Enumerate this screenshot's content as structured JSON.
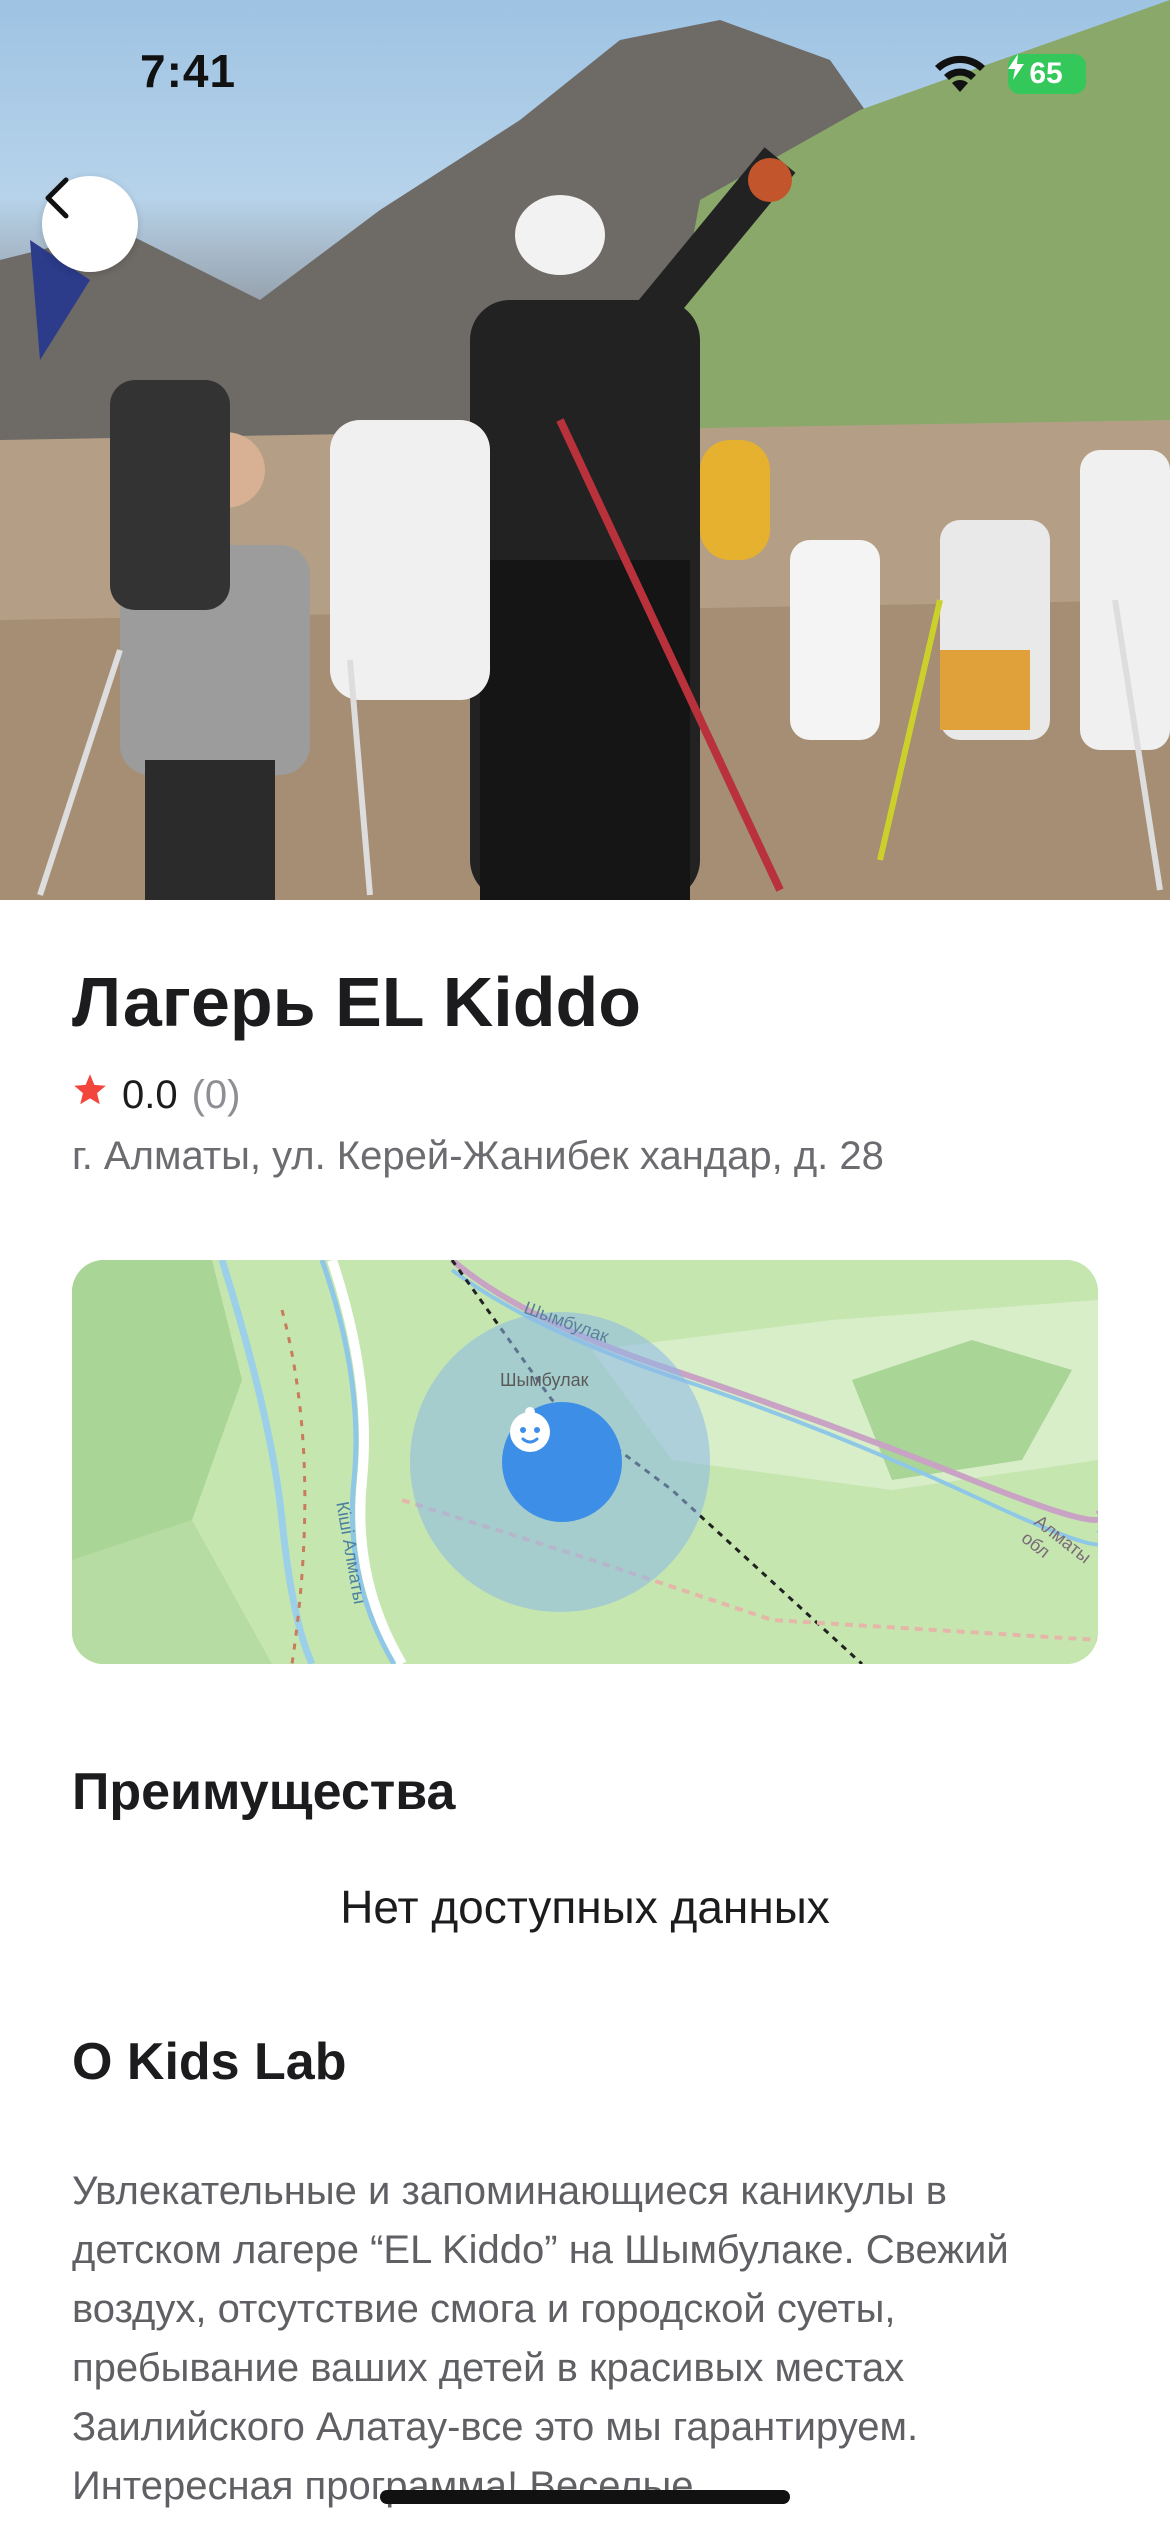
{
  "status_bar": {
    "time": "7:41",
    "battery_level": "65"
  },
  "camp": {
    "title": "Лагерь EL Kiddo",
    "rating": "0.0",
    "reviews_count": "(0)",
    "address": "г. Алматы, ул. Керей-Жанибек хандар, д. 28"
  },
  "map": {
    "labels": [
      "Шымбулак",
      "Шымбулак",
      "Кіші Алматы",
      "Алматы обл"
    ]
  },
  "advantages": {
    "heading": "Преимущества",
    "empty_text": "Нет доступных данных"
  },
  "about": {
    "heading": "О Kids Lab",
    "text": "Увлекательные и запоминающиеся каникулы в детском лагере “EL Kiddo” на Шымбулаке. Свежий воздух, отсутствие смога и городской суеты, пребывание ваших детей в красивых местах Заилийского Алатау-все это мы гарантируем. Интересная программа! Веселые"
  },
  "colors": {
    "star": "#f2463c",
    "pin": "#3d8ee6",
    "battery": "#34c759"
  },
  "icons": [
    "chevron-left-icon",
    "wifi-icon",
    "bolt-icon",
    "star-icon",
    "baby-face-icon"
  ]
}
